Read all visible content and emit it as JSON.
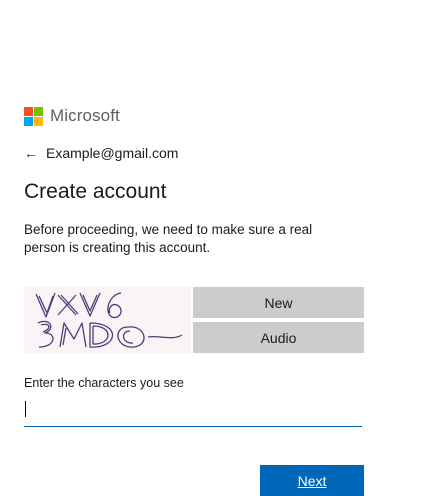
{
  "brand": {
    "name": "Microsoft",
    "logo_colors": [
      "#f25022",
      "#7fba00",
      "#00a4ef",
      "#ffb900"
    ]
  },
  "back": {
    "icon": "back-arrow-icon",
    "glyph": "←",
    "email": "Example@gmail.com"
  },
  "page": {
    "title": "Create account",
    "description": "Before proceeding, we need to make sure a real person is creating this account."
  },
  "captcha": {
    "characters": "VXV6 3MDO",
    "new_label": "New",
    "audio_label": "Audio"
  },
  "input": {
    "label": "Enter the characters you see",
    "value": ""
  },
  "actions": {
    "next_label": "Next"
  },
  "colors": {
    "accent": "#0067b8",
    "button_gray": "#cccccc"
  }
}
